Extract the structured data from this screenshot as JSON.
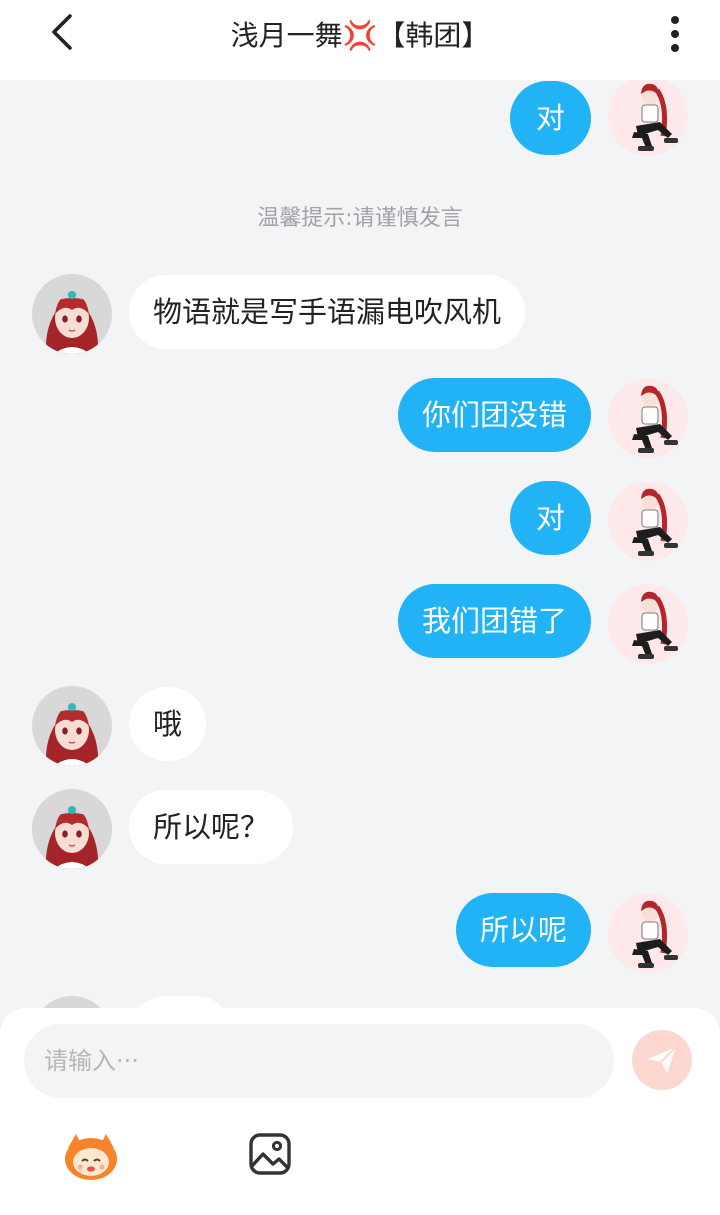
{
  "header": {
    "title": "浅月一舞💢【韩团】"
  },
  "chat": {
    "notice": "温馨提示:请谨慎发言",
    "messages": [
      {
        "from": "me",
        "text": "对"
      },
      {
        "from": "other",
        "text": "物语就是写手语漏电吹风机"
      },
      {
        "from": "me",
        "text": "你们团没错"
      },
      {
        "from": "me",
        "text": "对"
      },
      {
        "from": "me",
        "text": "我们团错了"
      },
      {
        "from": "other",
        "text": "哦"
      },
      {
        "from": "other",
        "text": "所以呢？"
      },
      {
        "from": "me",
        "text": "所以呢"
      }
    ]
  },
  "composer": {
    "placeholder": "请输入···"
  },
  "icons": {
    "back": "chevron-left-icon",
    "more": "vertical-dots-icon",
    "send": "paper-plane-icon",
    "emoji": "mascot-emoji-icon",
    "image": "image-icon"
  },
  "colors": {
    "my_bubble": "#21b3f5",
    "other_bubble": "#ffffff",
    "background": "#f3f4f6",
    "send_button": "#fbd7d0"
  }
}
